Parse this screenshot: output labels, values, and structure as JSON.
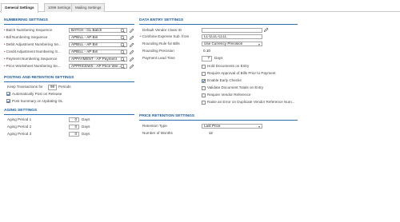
{
  "tabs": [
    {
      "label": "General Settings"
    },
    {
      "label": "1099 Settings"
    },
    {
      "label": "Mailing Settings"
    }
  ],
  "numbering": {
    "title": "NUMBERING SETTINGS",
    "rows": [
      {
        "label": "Batch Numbering Sequence",
        "value": "BATCH - GL Batch"
      },
      {
        "label": "Bill Numbering Sequence",
        "value": "APBILL - AP Bill"
      },
      {
        "label": "Debit Adjustment Numbering Se...",
        "value": "APBILL - AP Bill"
      },
      {
        "label": "Credit Adjustment Numbering S...",
        "value": "APBILL - AP Bill"
      },
      {
        "label": "Payment Numbering Sequence",
        "value": "APPAYMENT - AP Payment"
      },
      {
        "label": "Price Worksheet Numbering Se...",
        "value": "APPRICEWS - AP Price Wor..."
      }
    ]
  },
  "posting": {
    "title": "POSTING AND RETENTION SETTINGS",
    "keep_label": "Keep Transactions for",
    "keep_value": "99",
    "keep_unit": "Periods",
    "auto_post_label": "Automatically Post on Release",
    "auto_post_checked": true,
    "post_summary_label": "Post Summary on Updating GL",
    "post_summary_checked": true
  },
  "aging": {
    "title": "AGING SETTINGS",
    "rows": [
      {
        "label": "Aging Period 1",
        "value": "0",
        "unit": "Days"
      },
      {
        "label": "Aging Period 2",
        "value": "0",
        "unit": "Days"
      },
      {
        "label": "Aging Period 3",
        "value": "0",
        "unit": "Days"
      }
    ]
  },
  "data_entry": {
    "title": "DATA ENTRY SETTINGS",
    "vendor_class_label": "Default Vendor Class ID",
    "vendor_class_value": "",
    "combine_label": "Combine Expense Sub. from",
    "combine_value": "LL-LLLL-LLLL",
    "rounding_rule_label": "Rounding Rule for Bills",
    "rounding_rule_value": "Use Currency Precision",
    "rounding_precision_label": "Rounding Precision",
    "rounding_precision_value": "0.10",
    "lead_time_label": "Payment Lead Time",
    "lead_time_value": "7",
    "lead_time_unit": "Days",
    "checks": [
      {
        "label": "Hold Documents on Entry",
        "checked": false
      },
      {
        "label": "Require Approval of Bills Prior to Payment",
        "checked": false
      },
      {
        "label": "Enable Early Checks",
        "checked": true
      },
      {
        "label": "Validate Document Totals on Entry",
        "checked": false
      },
      {
        "label": "Require Vendor Reference",
        "checked": false
      },
      {
        "label": "Raise an Error on Duplicate Vendor Reference Num...",
        "checked": false
      }
    ]
  },
  "price_retention": {
    "title": "PRICE RETENTION SETTINGS",
    "type_label": "Retention Type",
    "type_value": "Last Price",
    "months_label": "Number of Months",
    "months_value": "12"
  },
  "colors": {
    "section_title": "#1a5a9a",
    "section_line": "#2a6db0",
    "required_star": "#c23c3c"
  }
}
